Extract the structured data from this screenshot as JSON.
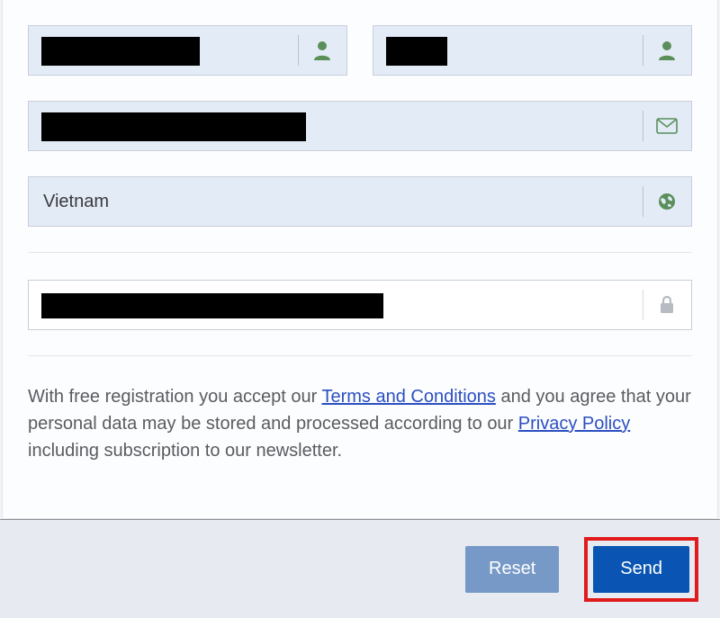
{
  "form": {
    "first_name": {
      "value": "",
      "redacted": true
    },
    "last_name": {
      "value": "",
      "redacted": true
    },
    "email": {
      "value": "",
      "redacted": true
    },
    "country": {
      "value": "Vietnam"
    },
    "password": {
      "value": "",
      "redacted": true
    }
  },
  "consent": {
    "part1": "With free registration you accept our ",
    "terms_link": "Terms and Conditions",
    "part2": " and you agree that your personal data may be stored and processed according to our ",
    "privacy_link": "Privacy Policy",
    "part3": " including subscription to our newsletter."
  },
  "buttons": {
    "reset": "Reset",
    "send": "Send"
  },
  "colors": {
    "field_bg": "#e3ebf7",
    "icon_green": "#5a8f5a",
    "icon_grey": "#b7bcc2",
    "link": "#2b4fc1",
    "primary": "#0a55b3",
    "secondary": "#7799c7",
    "highlight_border": "#e11b1b"
  }
}
